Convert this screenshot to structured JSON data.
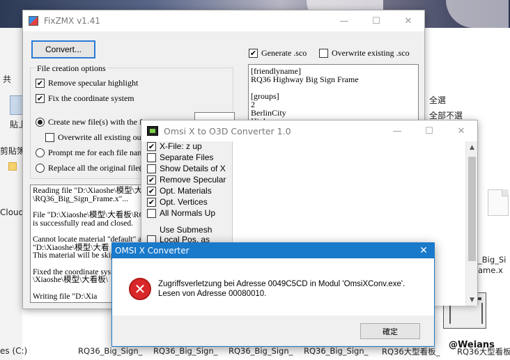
{
  "explorer": {
    "sidebar_frag_1": "共",
    "sidebar_frag_2": "貼上",
    "sidebar_frag_3": "剪貼簿",
    "sidebar_frag_4": "Cloud",
    "sidebar_frag_5": "es (C:)",
    "right_select_all": "全選",
    "right_select_none": "全部不選",
    "right_file_1": "_Big_Si",
    "right_file_2": "ame.x",
    "bottom_files": [
      "RQ36_Big_Sign_",
      "RQ36_Big_Sign_",
      "RQ36_Big_Sign_",
      "RQ36_Big_Sign_",
      "RQ36大型看板_",
      "RQ36大型看板_"
    ]
  },
  "fixzmx": {
    "title": "FixZMX v1.41",
    "convert_label": "Convert...",
    "generate_sco_label": "Generate .sco",
    "generate_sco_checked": "✔",
    "overwrite_sco_label": "Overwrite existing .sco",
    "file_options_label": "File creation options",
    "remove_specular_label": "Remove specular highlight",
    "fix_coords_label": "Fix the coordinate system",
    "create_new_label": "Create new file(s) with the fo",
    "overwrite_all_label": "Overwrite all existing outp",
    "prompt_label": "Prompt me for each file nam",
    "replace_label": "Replace all the original file(s",
    "sco_lines": [
      "[friendlyname]",
      "RQ36 Highway Big Sign Frame",
      "",
      "[groups]",
      "2",
      "BerlinCity",
      "Highway"
    ],
    "log_paragraphs": [
      "Reading file \"D:\\Xiaoshe\\模型\\大\n\\RQ36_Big_Sign_Frame.x\"...",
      "File \"D:\\Xiaoshe\\模型\\大看板\\RQ\nis successfully read and closed.",
      "Cannot locate material \"default\" a\n\"D:\\Xiaoshe\\模型\\大看\nThis material will be skip",
      "Fixed the coordinate sys\n\\Xiaoshe\\模型\\大看板\\",
      "Writing file \"D:\\Xia"
    ]
  },
  "o3d": {
    "title": "Omsi X to O3D Converter 1.0",
    "options": [
      {
        "label": "X-File: z up",
        "checked": "✔"
      },
      {
        "label": "Separate Files",
        "checked": ""
      },
      {
        "label": "Show Details of X",
        "checked": ""
      },
      {
        "label": "Remove Specular",
        "checked": "✔"
      },
      {
        "label": "Opt. Materials",
        "checked": "✔"
      },
      {
        "label": "Opt. Vertices",
        "checked": "✔"
      },
      {
        "label": "All Normals Up",
        "checked": ""
      },
      {
        "label": "Use Submesh",
        "checked": ""
      },
      {
        "label": "Local Pos. as",
        "checked": ""
      }
    ]
  },
  "error_dialog": {
    "title": "OMSI X Converter",
    "message_line_1": "Zugriffsverletzung bei Adresse 0049C5CD in Modul 'OmsiXConv.exe'.",
    "message_line_2": "Lesen von Adresse 00080010.",
    "ok_label": "確定",
    "icon_glyph": "✕"
  },
  "window_controls": {
    "minimize": "—",
    "maximize": "☐",
    "close": "✕"
  },
  "watermark": "@Weians"
}
